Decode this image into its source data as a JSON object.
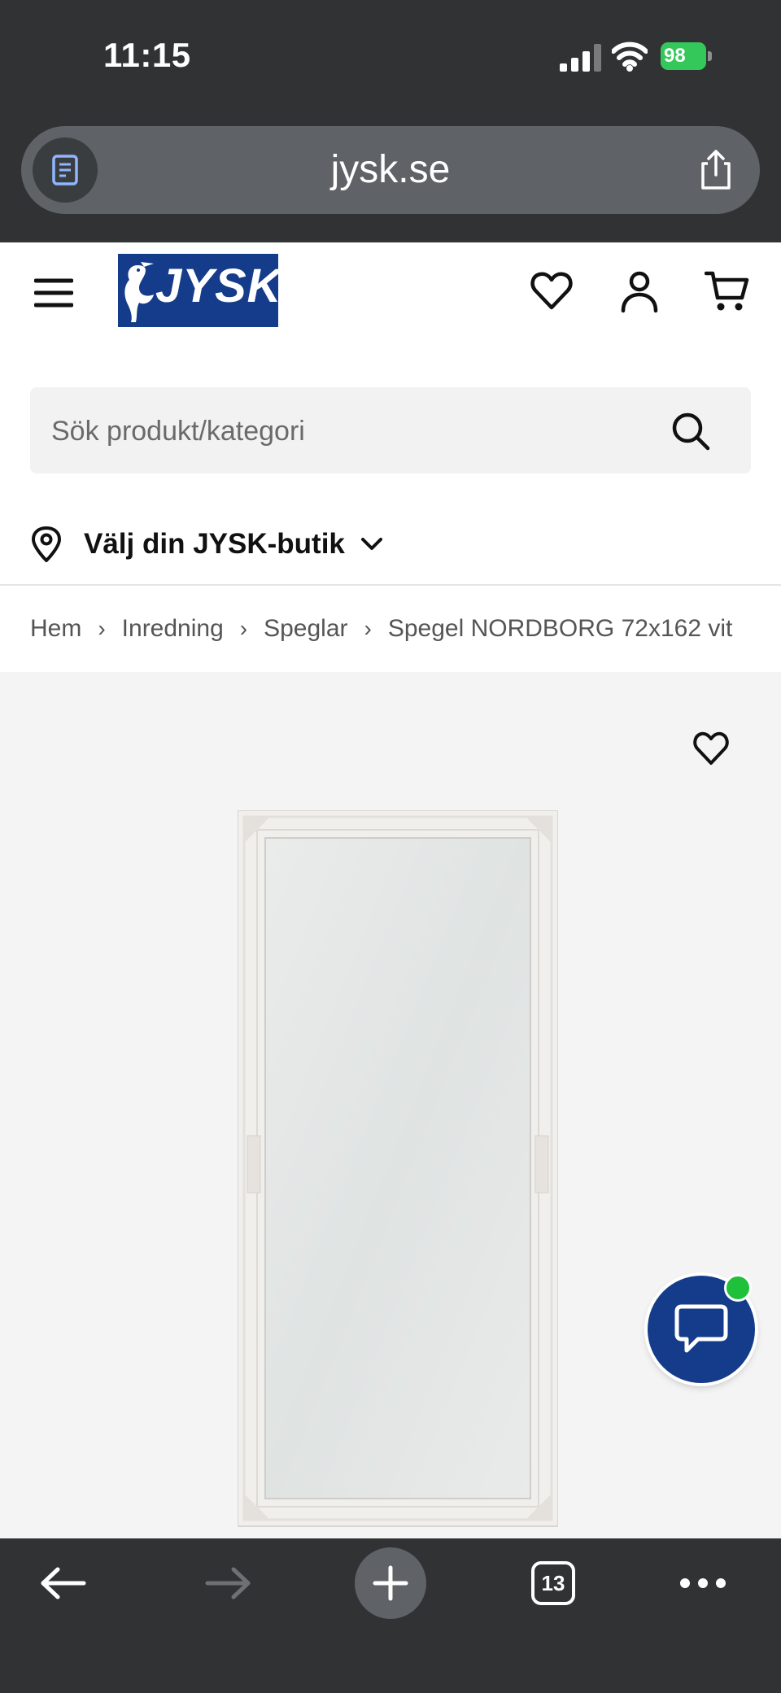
{
  "status_bar": {
    "time": "11:15",
    "battery": "98"
  },
  "browser": {
    "url": "jysk.se",
    "tab_count": "13"
  },
  "header": {
    "logo_text": "JYSK"
  },
  "search": {
    "placeholder": "Sök produkt/kategori"
  },
  "store": {
    "label": "Välj din JYSK-butik"
  },
  "breadcrumbs": [
    "Hem",
    "Inredning",
    "Speglar",
    "Spegel NORDBORG 72x162 vit"
  ],
  "colors": {
    "brand": "#143c8a",
    "chrome": "#303234",
    "online": "#1fc13a"
  },
  "icons": {
    "header": [
      "hamburger-menu-icon",
      "heart-icon",
      "user-icon",
      "cart-icon"
    ],
    "toolbar": [
      "back-arrow-icon",
      "forward-arrow-icon",
      "plus-icon",
      "tabs-icon",
      "more-icon"
    ]
  }
}
